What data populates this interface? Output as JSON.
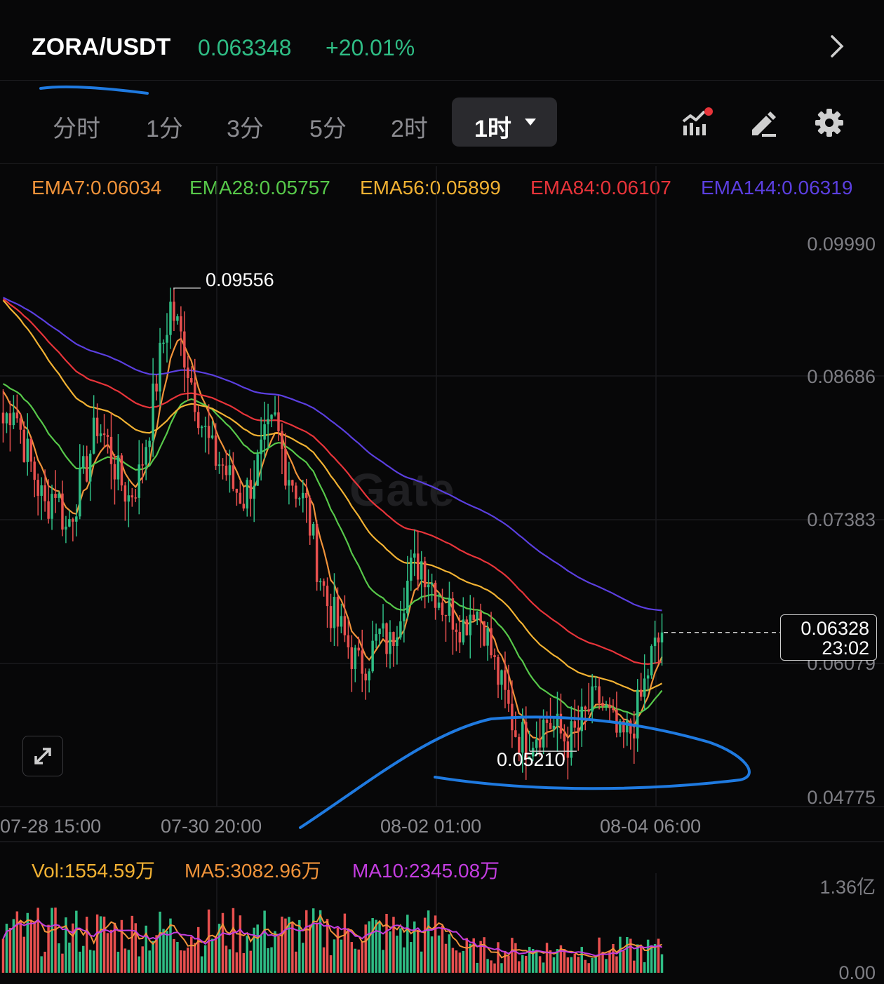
{
  "header": {
    "pair": "ZORA/USDT",
    "price": "0.063348",
    "change": "+20.01%",
    "colors": {
      "up": "#2fbd85",
      "down": "#e8504f"
    }
  },
  "toolbar": {
    "tabs": [
      "分时",
      "1分",
      "3分",
      "5分",
      "2时"
    ],
    "active_tab": "1时",
    "icons": [
      "indicator-icon",
      "draw-icon",
      "settings-icon"
    ]
  },
  "ema_legend": [
    {
      "label": "EMA7:0.06034",
      "color": "#f0933a"
    },
    {
      "label": "EMA28:0.05757",
      "color": "#57c84a"
    },
    {
      "label": "EMA56:0.05899",
      "color": "#f2b233"
    },
    {
      "label": "EMA84:0.06107",
      "color": "#e8343a"
    },
    {
      "label": "EMA144:0.06319",
      "color": "#5b3fe0"
    }
  ],
  "price_axis": [
    "0.09990",
    "0.08686",
    "0.07383",
    "0.06079",
    "0.04775"
  ],
  "time_axis": [
    "07-28 15:00",
    "07-30 20:00",
    "08-02 01:00",
    "08-04 06:00"
  ],
  "watermark": "Gate",
  "high_label": "0.09556",
  "low_label": "0.05210",
  "last_price_tag": {
    "value": "0.06328",
    "time": "23:02"
  },
  "volume": {
    "vol": "Vol:1554.59万",
    "ma5": "MA5:3082.96万",
    "ma10": "MA10:2345.08万",
    "axis_top": "1.36亿",
    "axis_bottom": "0.00"
  },
  "chart_data": {
    "type": "candlestick",
    "y_range": [
      0.04775,
      0.0999
    ],
    "high": 0.09556,
    "low": 0.0521,
    "last": 0.06328,
    "ema_values": {
      "EMA7": 0.06034,
      "EMA28": 0.05757,
      "EMA56": 0.05899,
      "EMA84": 0.06107,
      "EMA144": 0.06319
    },
    "close_path": [
      0.083,
      0.085,
      0.081,
      0.078,
      0.075,
      0.077,
      0.073,
      0.076,
      0.079,
      0.083,
      0.081,
      0.078,
      0.076,
      0.078,
      0.083,
      0.089,
      0.094,
      0.091,
      0.087,
      0.083,
      0.08,
      0.079,
      0.077,
      0.076,
      0.078,
      0.081,
      0.083,
      0.079,
      0.077,
      0.075,
      0.07,
      0.066,
      0.064,
      0.062,
      0.06,
      0.061,
      0.063,
      0.062,
      0.066,
      0.069,
      0.07,
      0.068,
      0.066,
      0.065,
      0.064,
      0.066,
      0.064,
      0.06,
      0.057,
      0.054,
      0.053,
      0.054,
      0.055,
      0.054,
      0.053,
      0.054,
      0.056,
      0.057,
      0.055,
      0.053,
      0.054,
      0.057,
      0.061,
      0.063
    ]
  }
}
